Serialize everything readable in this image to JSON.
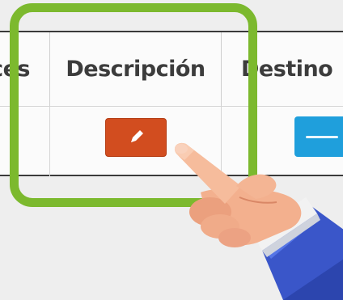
{
  "table": {
    "columns": [
      {
        "label": "ces"
      },
      {
        "label": "Descripción"
      },
      {
        "label": "Destino"
      }
    ]
  },
  "row": {
    "edit_button": {
      "icon": "pencil-icon",
      "color": "#d24d1f"
    },
    "destination_button": {
      "icon": "minus-icon",
      "color": "#1f9fdc"
    }
  },
  "overlay": {
    "highlight_color": "#7cb92e",
    "pointer": "pointing-hand-icon"
  }
}
